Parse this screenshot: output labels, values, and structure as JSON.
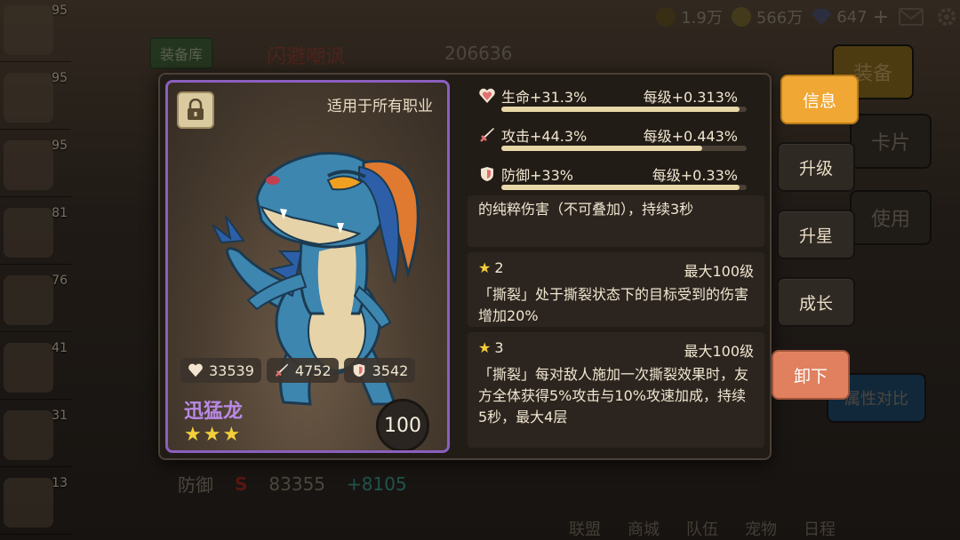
{
  "background": {
    "currencies": [
      {
        "icon": "stamina-icon",
        "value": "1.9万"
      },
      {
        "icon": "gold-coin-icon",
        "value": "566万"
      },
      {
        "icon": "gem-icon",
        "value": "647"
      }
    ],
    "hero_levels": [
      "95",
      "95",
      "95",
      "81",
      "76",
      "41",
      "31",
      "13"
    ],
    "tab_label": "装备库",
    "hero_name": "闪避嘲讽",
    "power": "206636",
    "right_buttons": [
      "装备",
      "卡片",
      "使用"
    ],
    "compare_label": "属性对比",
    "defense_label": "防御",
    "defense_rank": "S",
    "defense_value": "83355",
    "defense_gain": "+8105",
    "bottom_nav": [
      "联盟",
      "商城",
      "队伍",
      "宠物",
      "日程"
    ]
  },
  "card": {
    "job_text": "适用于所有职业",
    "hp": "33539",
    "attack": "4752",
    "defense": "3542",
    "name": "迅猛龙",
    "stars": "★★★",
    "level": "100",
    "border_color": "#8b5fbf"
  },
  "stats": [
    {
      "icon": "heart-icon",
      "label": "生命+31.3%",
      "per_level": "每级+0.313%",
      "progress": 0.97
    },
    {
      "icon": "sword-icon",
      "label": "攻击+44.3%",
      "per_level": "每级+0.443%",
      "progress": 0.82
    },
    {
      "icon": "shield-icon",
      "label": "防御+33%",
      "per_level": "每级+0.33%",
      "progress": 0.97
    }
  ],
  "skills": [
    {
      "text": "的纯粹伤害（不可叠加），持续3秒"
    },
    {
      "star": "★",
      "num": "2",
      "max": "最大100级",
      "text": "「撕裂」处于撕裂状态下的目标受到的伤害增加20%"
    },
    {
      "star": "★",
      "num": "3",
      "max": "最大100级",
      "text": "「撕裂」每对敌人施加一次撕裂效果时，友方全体获得5%攻击与10%攻速加成，持续5秒，最大4层"
    }
  ],
  "side_buttons": {
    "info": "信息",
    "upgrade": "升级",
    "star_up": "升星",
    "grow": "成长",
    "unequip": "卸下"
  },
  "colors": {
    "accent": "#f0a733",
    "danger": "#e0805e",
    "star": "#f3cf3b",
    "name": "#b989e6"
  }
}
